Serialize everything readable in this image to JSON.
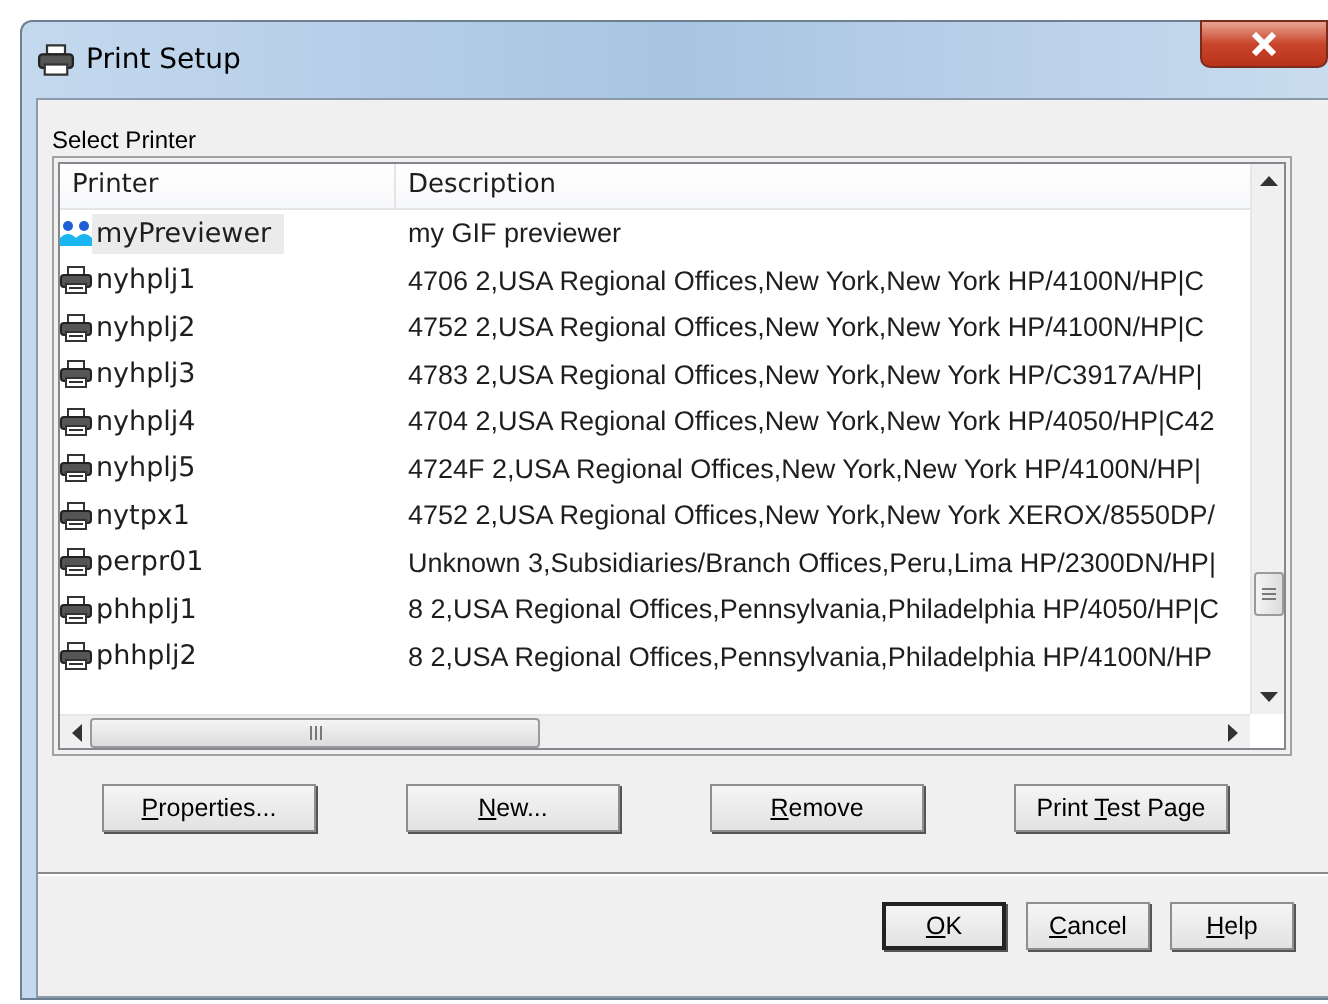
{
  "window": {
    "title": "Print Setup"
  },
  "group_label": "Select Printer",
  "table": {
    "columns": [
      "Printer",
      "Description"
    ],
    "rows": [
      {
        "kind": "group",
        "name": "myPreviewer",
        "description": "my GIF previewer",
        "selected": true
      },
      {
        "kind": "printer",
        "name": "nyhplj1",
        "description": "4706 2,USA Regional Offices,New York,New York HP/4100N/HP|C",
        "selected": false
      },
      {
        "kind": "printer",
        "name": "nyhplj2",
        "description": "4752 2,USA Regional Offices,New York,New York HP/4100N/HP|C",
        "selected": false
      },
      {
        "kind": "printer",
        "name": "nyhplj3",
        "description": "4783 2,USA Regional Offices,New York,New York HP/C3917A/HP|",
        "selected": false
      },
      {
        "kind": "printer",
        "name": "nyhplj4",
        "description": "4704 2,USA Regional Offices,New York,New York HP/4050/HP|C42",
        "selected": false
      },
      {
        "kind": "printer",
        "name": "nyhplj5",
        "description": "4724F 2,USA Regional Offices,New York,New York HP/4100N/HP|",
        "selected": false
      },
      {
        "kind": "printer",
        "name": "nytpx1",
        "description": "4752 2,USA Regional Offices,New York,New York XEROX/8550DP/",
        "selected": false
      },
      {
        "kind": "printer",
        "name": "perpr01",
        "description": "Unknown 3,Subsidiaries/Branch Offices,Peru,Lima HP/2300DN/HP|",
        "selected": false
      },
      {
        "kind": "printer",
        "name": "phhplj1",
        "description": "8 2,USA Regional Offices,Pennsylvania,Philadelphia HP/4050/HP|C",
        "selected": false
      },
      {
        "kind": "printer",
        "name": "phhplj2",
        "description": "8 2,USA Regional Offices,Pennsylvania,Philadelphia HP/4100N/HP",
        "selected": false
      }
    ]
  },
  "printer_buttons": [
    {
      "access_key": "P",
      "rest": "roperties..."
    },
    {
      "access_key": "N",
      "rest": "ew..."
    },
    {
      "access_key": "R",
      "rest": "emove"
    },
    {
      "before": "Print ",
      "access_key": "T",
      "rest": "est Page"
    }
  ],
  "dialog_buttons": [
    {
      "access_key": "O",
      "rest": "K",
      "default": true
    },
    {
      "access_key": "C",
      "rest": "ancel",
      "default": false
    },
    {
      "access_key": "H",
      "rest": "elp",
      "default": false
    }
  ]
}
